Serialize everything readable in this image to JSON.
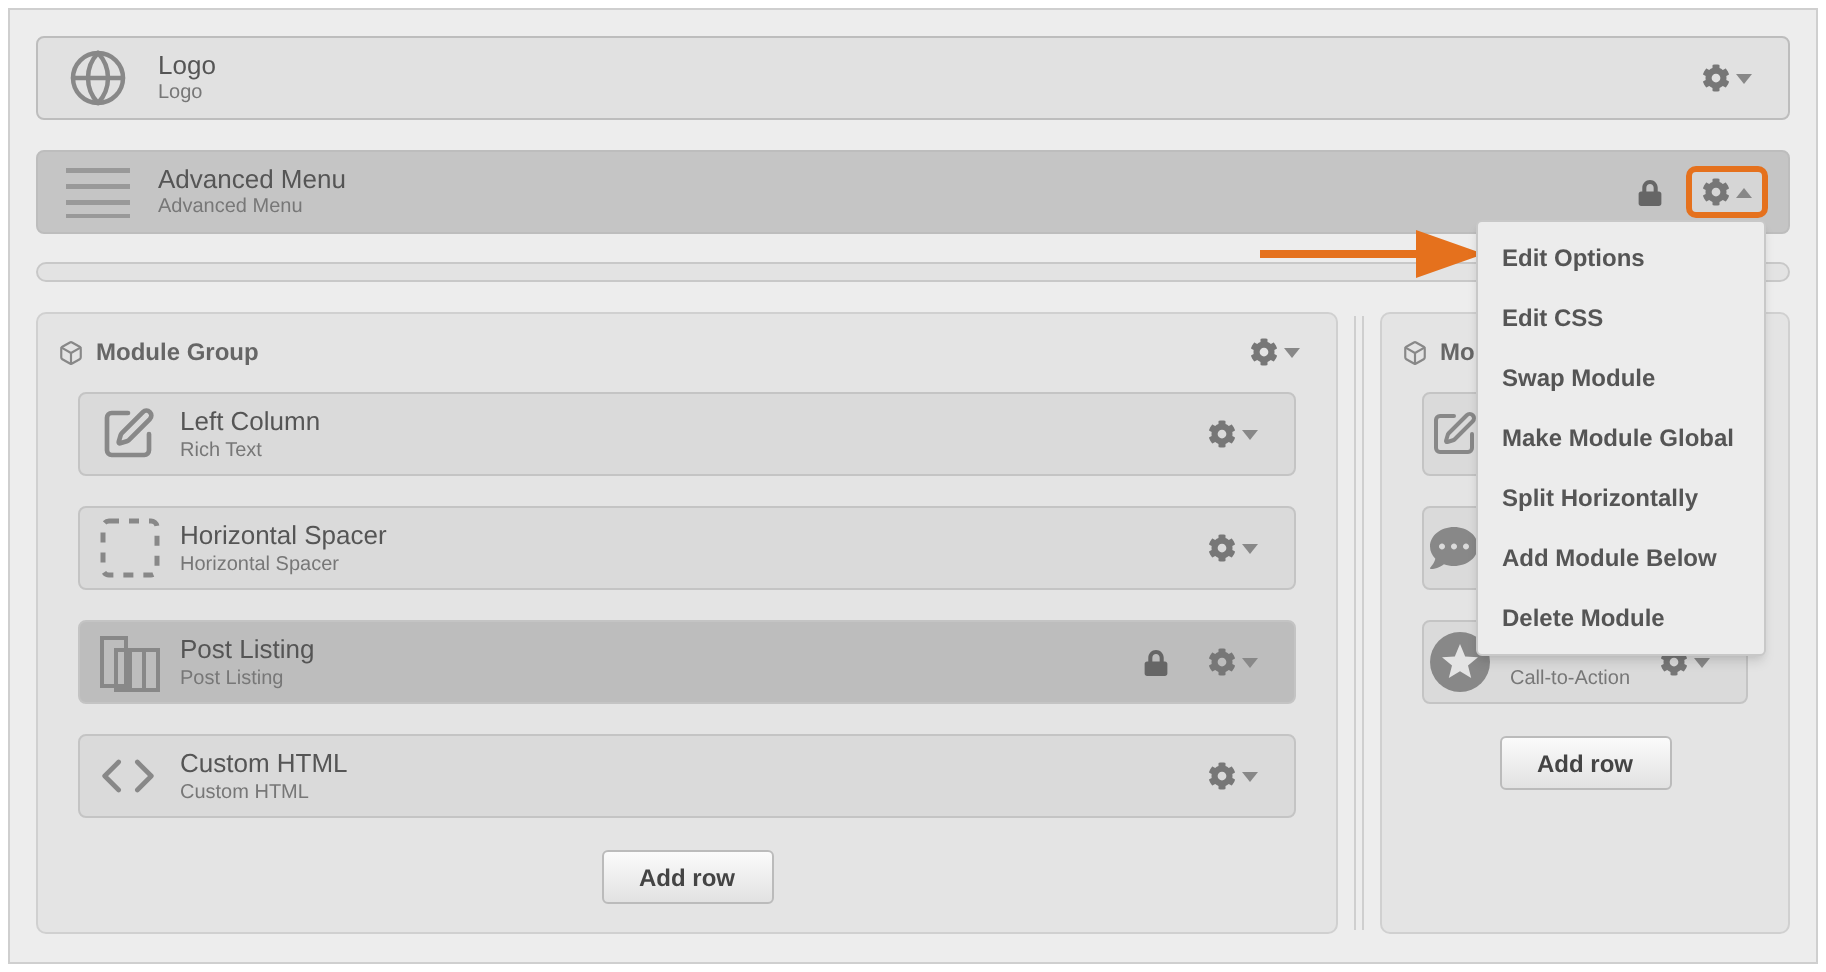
{
  "rows": [
    {
      "kind": "globe",
      "title": "Logo",
      "subtitle": "Logo",
      "locked": false,
      "menu_open": false
    },
    {
      "kind": "lines",
      "title": "Advanced Menu",
      "subtitle": "Advanced Menu",
      "locked": true,
      "menu_open": true
    }
  ],
  "groups": [
    {
      "title": "Module Group",
      "modules": [
        {
          "kind": "edit",
          "title": "Left Column",
          "subtitle": "Rich Text",
          "locked": false
        },
        {
          "kind": "spacer",
          "title": "Horizontal Spacer",
          "subtitle": "Horizontal Spacer",
          "locked": false
        },
        {
          "kind": "listing",
          "title": "Post Listing",
          "subtitle": "Post Listing",
          "locked": true
        },
        {
          "kind": "code",
          "title": "Custom HTML",
          "subtitle": "Custom HTML",
          "locked": false
        }
      ],
      "add_button": "Add row"
    },
    {
      "title": "Mo",
      "modules": [
        {
          "kind": "edit",
          "locked": false
        },
        {
          "kind": "chat",
          "locked": false
        },
        {
          "kind": "star",
          "subtitle": "Call-to-Action",
          "locked": false
        }
      ],
      "add_button": "Add row"
    }
  ],
  "menu": {
    "items": [
      "Edit Options",
      "Edit CSS",
      "Swap Module",
      "Make Module Global",
      "Split Horizontally",
      "Add Module Below",
      "Delete Module"
    ]
  }
}
